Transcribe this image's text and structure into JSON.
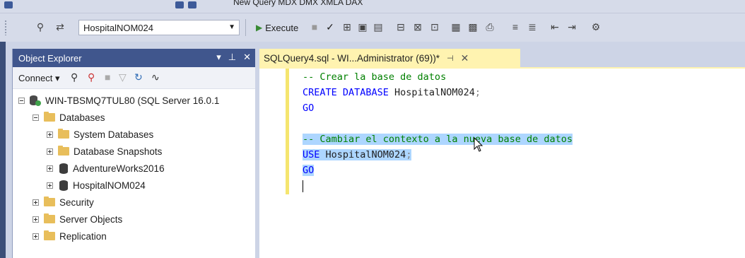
{
  "toolbar_top": {
    "partial_text": "New Query   MDX  DMX  XMLA  DAX"
  },
  "toolbar": {
    "database_selected": "HospitalNOM024",
    "execute_label": "Execute"
  },
  "object_explorer": {
    "title": "Object Explorer",
    "connect_label": "Connect",
    "tree": {
      "server": "WIN-TBSMQ7TUL80 (SQL Server 16.0.1",
      "databases": "Databases",
      "system_databases": "System Databases",
      "database_snapshots": "Database Snapshots",
      "adventureworks": "AdventureWorks2016",
      "hospital": "HospitalNOM024",
      "security": "Security",
      "server_objects": "Server Objects",
      "replication": "Replication"
    }
  },
  "editor": {
    "tab_label": "SQLQuery4.sql - WI...Administrator (69))*",
    "lines": {
      "l1": "-- Crear la base de datos",
      "l2_kw": "CREATE DATABASE",
      "l2_id": " HospitalNOM024",
      "l2_pun": ";",
      "l3": "GO",
      "l5": "-- Cambiar el contexto a la nueva base de datos",
      "l6_kw": "USE",
      "l6_id": " HospitalNOM024",
      "l6_pun": ";",
      "l7": "GO"
    }
  },
  "icons": {
    "execute": "play-icon",
    "parse": "checkmark-icon",
    "close": "close-icon",
    "pin": "pin-icon",
    "refresh": "refresh-icon",
    "filter": "filter-icon"
  },
  "colors": {
    "keyword": "#0000ff",
    "comment": "#008000",
    "selection": "#add6ff",
    "tab_active": "#fff3b0",
    "panel_header": "#40568d"
  }
}
